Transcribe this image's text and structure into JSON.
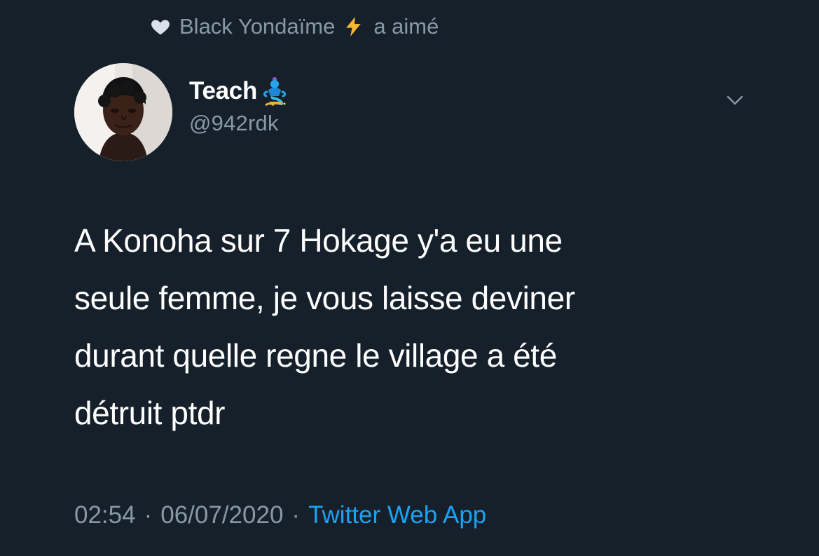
{
  "liked_by": {
    "icon": "heart-icon",
    "name": "Black Yondaïme",
    "badge_icon": "lightning-bolt-icon",
    "action": "a aimé"
  },
  "tweet": {
    "author": {
      "display_name": "Teach",
      "name_emoji_icon": "genie-emoji-icon",
      "handle": "@942rdk"
    },
    "menu_icon": "chevron-down-icon",
    "text": "A Konoha sur 7 Hokage y'a eu une\nseule femme, je vous laisse deviner\ndurant quelle regne le village a été\ndétruit ptdr",
    "time": "02:54",
    "separator": "·",
    "date": "06/07/2020",
    "source": "Twitter Web App"
  },
  "colors": {
    "background": "#15202b",
    "primary_text": "#ffffff",
    "secondary_text": "#8899a6",
    "link": "#1da1f2",
    "bolt": "#f7b731"
  }
}
